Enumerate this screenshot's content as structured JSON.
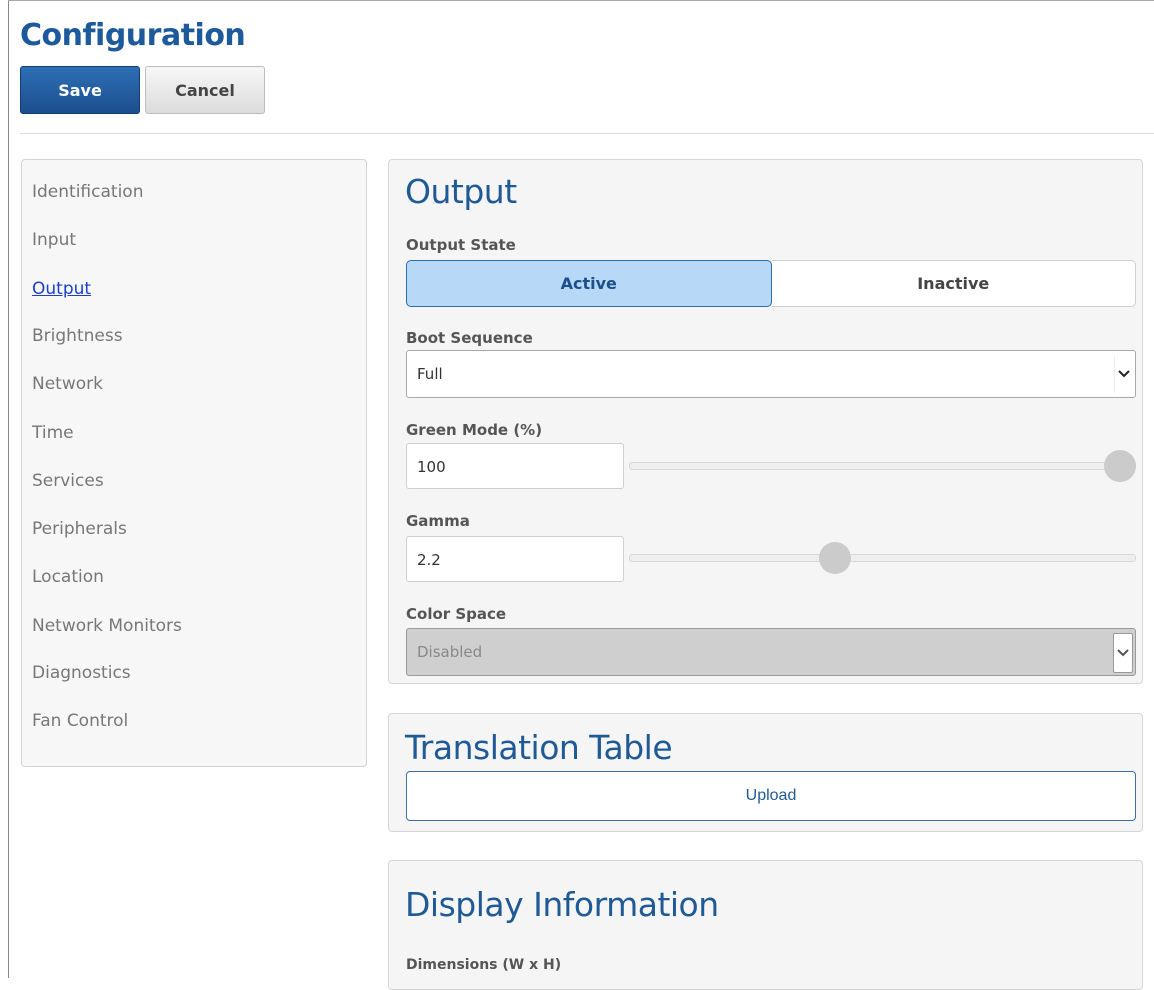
{
  "header": {
    "title": "Configuration",
    "save_label": "Save",
    "cancel_label": "Cancel"
  },
  "sidebar": {
    "active": "Output",
    "items": [
      {
        "label": "Identification"
      },
      {
        "label": "Input"
      },
      {
        "label": "Output"
      },
      {
        "label": "Brightness"
      },
      {
        "label": "Network"
      },
      {
        "label": "Time"
      },
      {
        "label": "Services"
      },
      {
        "label": "Peripherals"
      },
      {
        "label": "Location"
      },
      {
        "label": "Network Monitors"
      },
      {
        "label": "Diagnostics"
      },
      {
        "label": "Fan Control"
      }
    ]
  },
  "output": {
    "title": "Output",
    "output_state": {
      "label": "Output State",
      "options": [
        "Active",
        "Inactive"
      ],
      "selected": "Active"
    },
    "boot_sequence": {
      "label": "Boot Sequence",
      "value": "Full"
    },
    "green_mode": {
      "label": "Green Mode (%)",
      "value": "100",
      "slider_level": 1.0
    },
    "gamma": {
      "label": "Gamma",
      "value": "2.2",
      "slider_level": 0.4
    },
    "color_space": {
      "label": "Color Space",
      "value": "Disabled",
      "disabled": true
    }
  },
  "translation_table": {
    "title": "Translation Table",
    "upload_label": "Upload"
  },
  "display_information": {
    "title": "Display Information",
    "dimensions_label": "Dimensions (W x H)"
  },
  "colors": {
    "accent": "#1d5a9c",
    "active_segment": "#b8d8f8",
    "link": "#1a3fcc"
  },
  "icons": {
    "select_arrow": "chevron-down-icon"
  }
}
